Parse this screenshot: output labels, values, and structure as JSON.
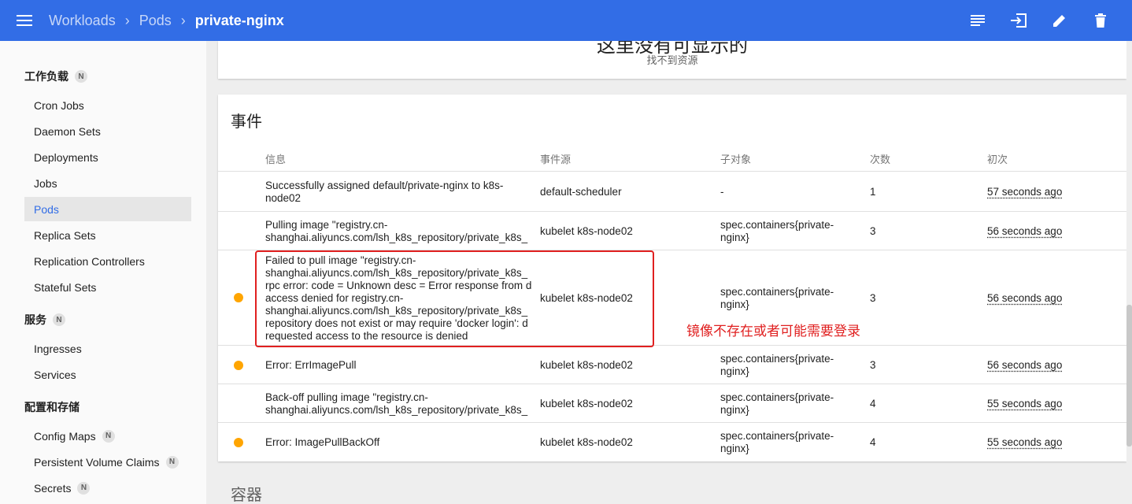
{
  "breadcrumb": {
    "workloads": "Workloads",
    "pods": "Pods",
    "current": "private-nginx"
  },
  "actions": [
    "logs-icon",
    "exec-icon",
    "edit-icon",
    "delete-icon"
  ],
  "sidebar": {
    "workloads_header": "工作负载",
    "workloads_badge": "N",
    "workload_items": [
      "Cron Jobs",
      "Daemon Sets",
      "Deployments",
      "Jobs",
      "Pods",
      "Replica Sets",
      "Replication Controllers",
      "Stateful Sets"
    ],
    "active_item": "Pods",
    "services_header": "服务",
    "services_badge": "N",
    "service_items": [
      "Ingresses",
      "Services"
    ],
    "config_header": "配置和存储",
    "config_items": [
      {
        "label": "Config Maps",
        "badge": "N"
      },
      {
        "label": "Persistent Volume Claims",
        "badge": "N"
      },
      {
        "label": "Secrets",
        "badge": "N"
      }
    ]
  },
  "resource_card": {
    "clipped_title": "这里没有可显示的",
    "empty_text": "找不到资源"
  },
  "events": {
    "title": "事件",
    "columns": {
      "message": "信息",
      "source": "事件源",
      "subobject": "子对象",
      "count": "次数",
      "first": "初次"
    },
    "rows": [
      {
        "warning": false,
        "message": "Successfully assigned default/private-nginx to k8s-\nnode02",
        "source": "default-scheduler",
        "subobject": "-",
        "count": "1",
        "first": "57 seconds ago"
      },
      {
        "warning": false,
        "message": "Pulling image \"registry.cn-\nshanghai.aliyuncs.com/lsh_k8s_repository/private_k8s_",
        "source": "kubelet k8s-node02",
        "subobject": "spec.containers{private-\nnginx}",
        "count": "3",
        "first": "56 seconds ago"
      },
      {
        "warning": true,
        "message": "Failed to pull image \"registry.cn-\nshanghai.aliyuncs.com/lsh_k8s_repository/private_k8s_\nrpc error: code = Unknown desc = Error response from d\naccess denied for registry.cn-\nshanghai.aliyuncs.com/lsh_k8s_repository/private_k8s_\nrepository does not exist or may require 'docker login': d\nrequested access to the resource is denied",
        "source": "kubelet k8s-node02",
        "subobject": "spec.containers{private-\nnginx}",
        "count": "3",
        "first": "56 seconds ago"
      },
      {
        "warning": true,
        "message": "Error: ErrImagePull",
        "source": "kubelet k8s-node02",
        "subobject": "spec.containers{private-\nnginx}",
        "count": "3",
        "first": "56 seconds ago"
      },
      {
        "warning": false,
        "message": "Back-off pulling image \"registry.cn-\nshanghai.aliyuncs.com/lsh_k8s_repository/private_k8s_",
        "source": "kubelet k8s-node02",
        "subobject": "spec.containers{private-\nnginx}",
        "count": "4",
        "first": "55 seconds ago"
      },
      {
        "warning": true,
        "message": "Error: ImagePullBackOff",
        "source": "kubelet k8s-node02",
        "subobject": "spec.containers{private-\nnginx}",
        "count": "4",
        "first": "55 seconds ago"
      }
    ]
  },
  "annotation": "镜像不存在或者可能需要登录",
  "containers_title": "容器",
  "colors": {
    "primary": "#326de6",
    "warning": "#ffa500",
    "annotation": "#e02020"
  }
}
